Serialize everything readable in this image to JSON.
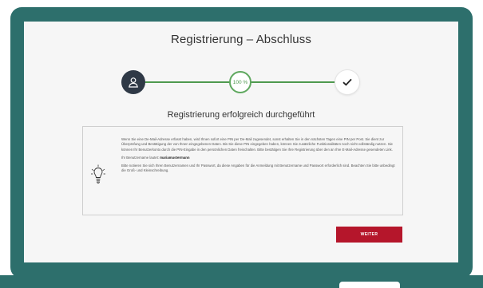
{
  "page": {
    "title": "Registrierung – Abschluss",
    "progress_label": "100 %",
    "progress_value": 100,
    "subtitle": "Registrierung erfolgreich durchgeführt"
  },
  "info": {
    "paragraph1": "Wenn Sie eine De-Mail-Adresse erfasst haben, wird Ihnen sofort eine PIN per De-Mail zugesendet, sonst erhalten Sie in den nächsten Tagen eine PIN per Post. Sie dient zur Überprüfung und Bestätigung der von Ihnen eingegebenen Daten. Bis Sie diese PIN eingegeben haben, können Sie zusätzliche Funktionalitäten noch nicht vollständig nutzen. Sie können Ihr Benutzerkonto durch die PIN-Eingabe in den persönlichen Daten freischalten. Bitte bestätigen Sie Ihre Registrierung über den an Ihre E-Mail-Adresse gesendeten Link.",
    "username_prefix": "Ihr Benutzername lautet:",
    "username": "mariamustermann",
    "paragraph3": "Bitte notieren Sie sich Ihren Benutzernamen und Ihr Passwort, da diese Angaben für die Anmeldung mit Benutzername und Passwort erforderlich sind. Beachten Sie bitte unbedingt die Groß- und Kleinschreibung."
  },
  "actions": {
    "next_label": "WEITER"
  },
  "colors": {
    "frame": "#2d6f6c",
    "accent_button": "#b5162b",
    "progress_green": "#4f9a4f",
    "step_dark": "#2f3946"
  },
  "icons": {
    "step1": "user-icon",
    "step3": "checkmark-icon",
    "info": "lightbulb-icon"
  }
}
